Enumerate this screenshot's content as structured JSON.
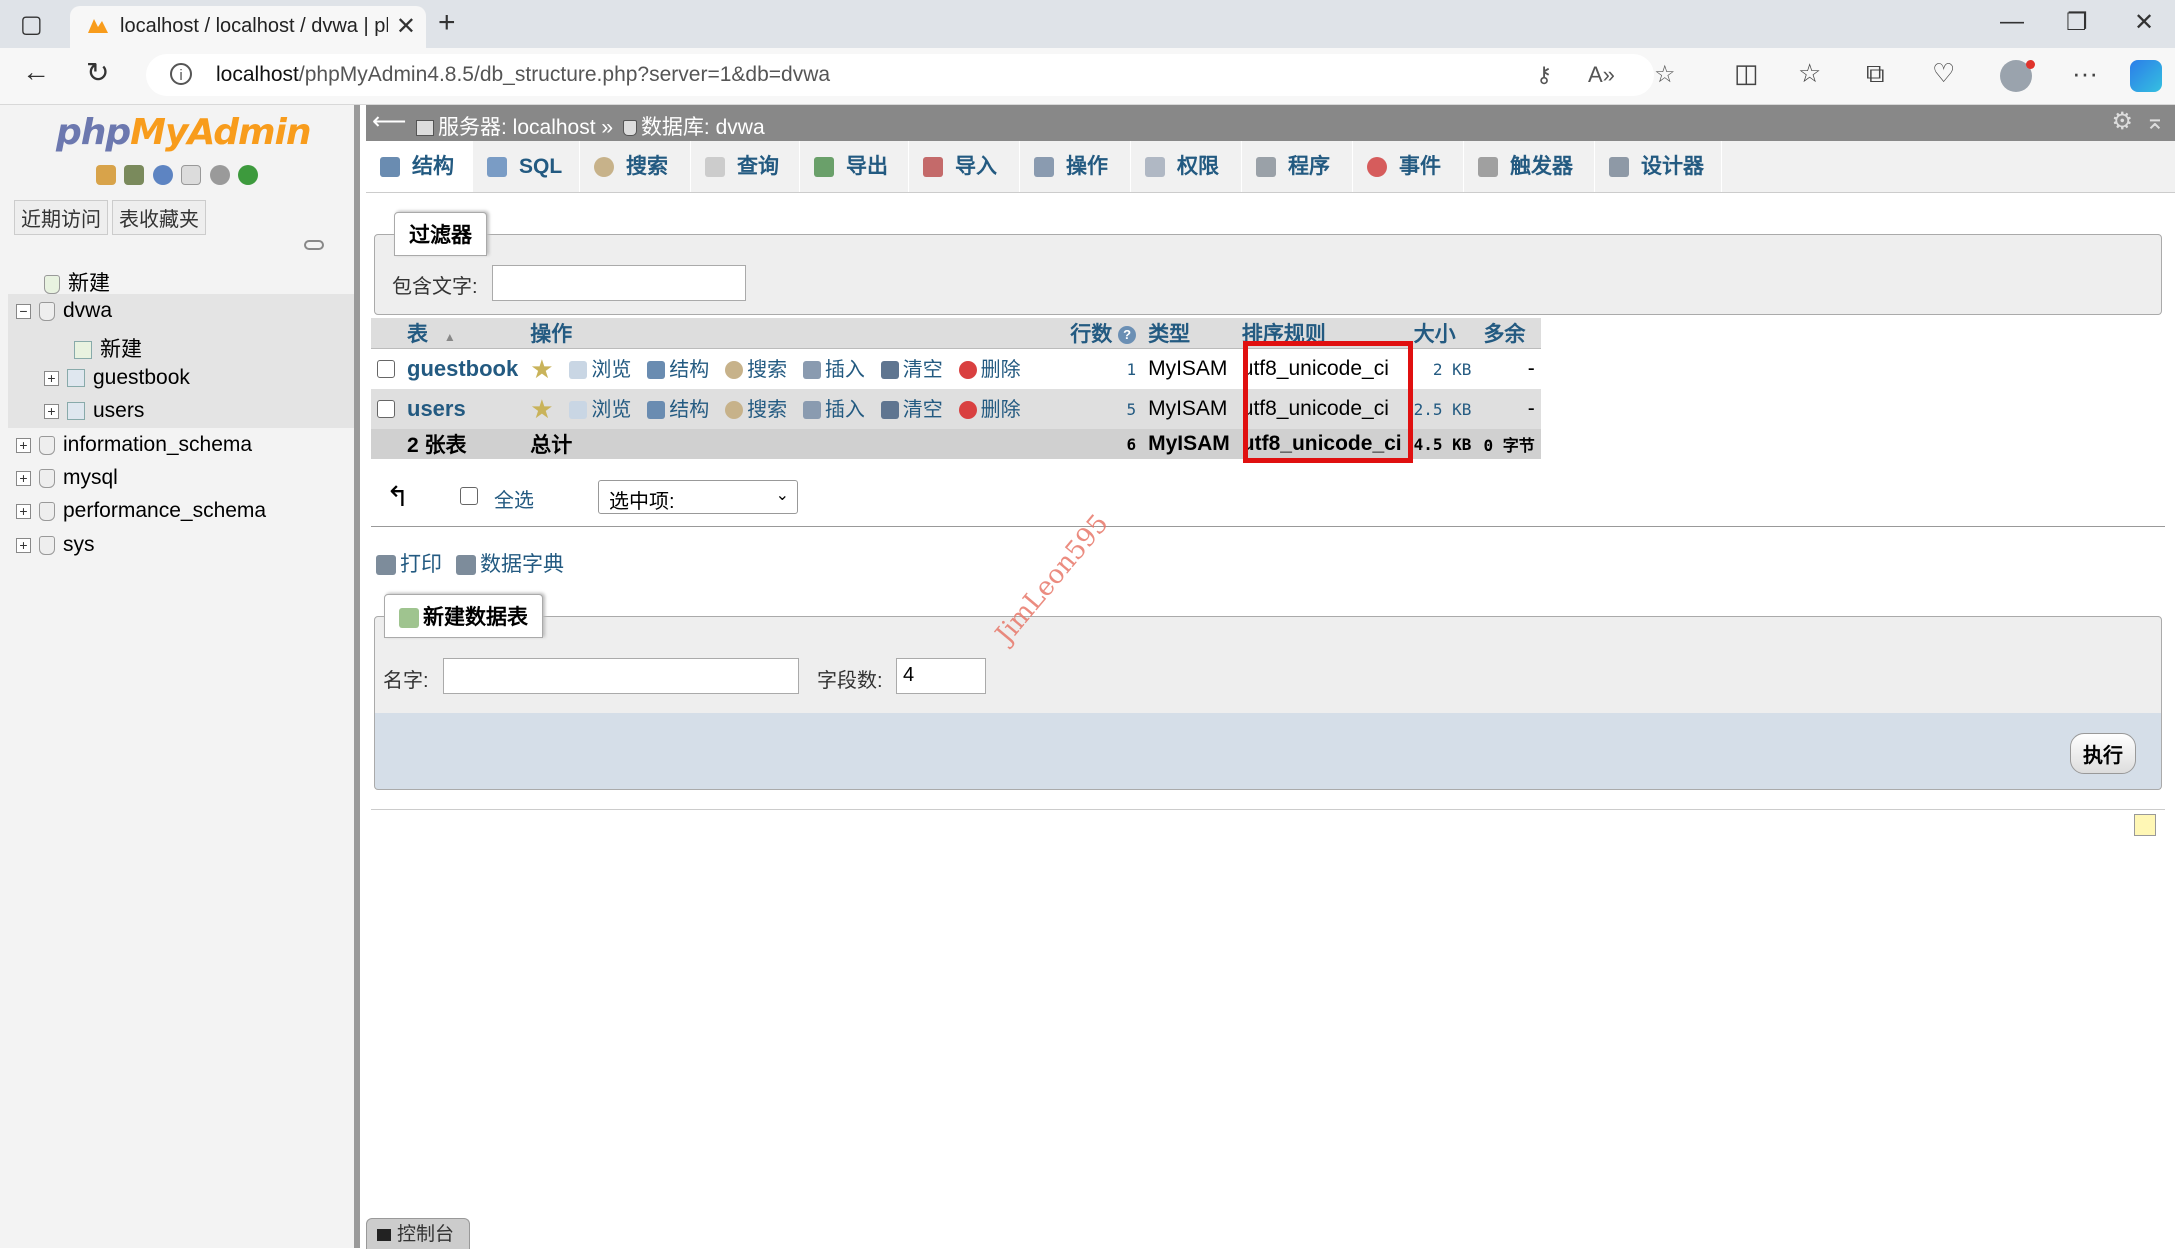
{
  "browser": {
    "tab_title": "localhost / localhost / dvwa | php",
    "url_host": "localhost",
    "url_path": "/phpMyAdmin4.8.5/db_structure.php?server=1&db=dvwa"
  },
  "nav": {
    "logo_php": "php",
    "logo_myadmin": "MyAdmin",
    "tabs": [
      "近期访问",
      "表收藏夹"
    ],
    "tree": {
      "new": "新建",
      "dvwa": "dvwa",
      "dvwa_new": "新建",
      "guestbook": "guestbook",
      "users": "users",
      "information_schema": "information_schema",
      "mysql": "mysql",
      "performance_schema": "performance_schema",
      "sys": "sys"
    }
  },
  "breadcrumb": {
    "server": "服务器: localhost",
    "sep": "»",
    "db": "数据库: dvwa"
  },
  "menu": [
    "结构",
    "SQL",
    "搜索",
    "查询",
    "导出",
    "导入",
    "操作",
    "权限",
    "程序",
    "事件",
    "触发器",
    "设计器"
  ],
  "filter": {
    "legend": "过滤器",
    "label": "包含文字:",
    "value": ""
  },
  "table_list": {
    "headers": {
      "table": "表",
      "sort_indicator": "▲",
      "action": "操作",
      "rows": "行数",
      "type": "类型",
      "collation": "排序规则",
      "size": "大小",
      "overhead": "多余"
    },
    "actions": [
      "浏览",
      "结构",
      "搜索",
      "插入",
      "清空",
      "删除"
    ],
    "rows": [
      {
        "name": "guestbook",
        "rows": "1",
        "type": "MyISAM",
        "collation": "utf8_unicode_ci",
        "size": "2 KB",
        "overhead": "-"
      },
      {
        "name": "users",
        "rows": "5",
        "type": "MyISAM",
        "collation": "utf8_unicode_ci",
        "size": "2.5 KB",
        "overhead": "-"
      }
    ],
    "total": {
      "count": "2 张表",
      "label": "总计",
      "rows": "6",
      "type": "MyISAM",
      "collation": "utf8_unicode_ci",
      "size": "4.5 KB",
      "overhead": "0 字节"
    }
  },
  "bulk": {
    "check_all": "全选",
    "with_selected": "选中项:"
  },
  "links": {
    "print": "打印",
    "dictionary": "数据字典"
  },
  "create_table": {
    "legend": "新建数据表",
    "name_label": "名字:",
    "name_value": "",
    "cols_label": "字段数:",
    "cols_value": "4",
    "go": "执行"
  },
  "watermark": "JimLeon595",
  "console": "控制台",
  "colors": {
    "link": "#235a81",
    "highlight_box": "#e01010",
    "topbar": "#888888"
  }
}
